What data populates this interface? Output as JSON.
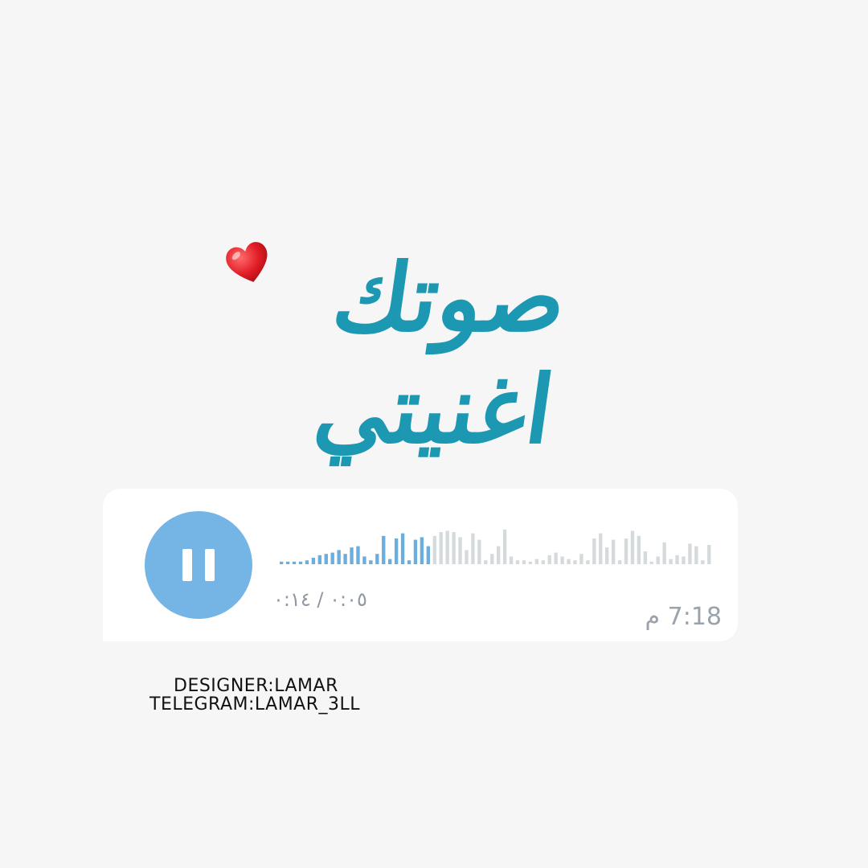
{
  "title": {
    "text": "صوتك اغنيتي",
    "emoji": "heart-emoji",
    "color": "#1d98b3"
  },
  "voice_message": {
    "button_state": "pause",
    "button_color": "#75b5e6",
    "duration_text": "٠:٠٥ / ٠:١٤",
    "progress": 0.357,
    "time": "7:18 م",
    "played_color": "#6aaee0",
    "unplayed_color": "#d5dadd"
  },
  "credits": {
    "designer": "DESIGNER:LAMAR",
    "telegram": "TELEGRAM:LAMAR_3LL"
  }
}
